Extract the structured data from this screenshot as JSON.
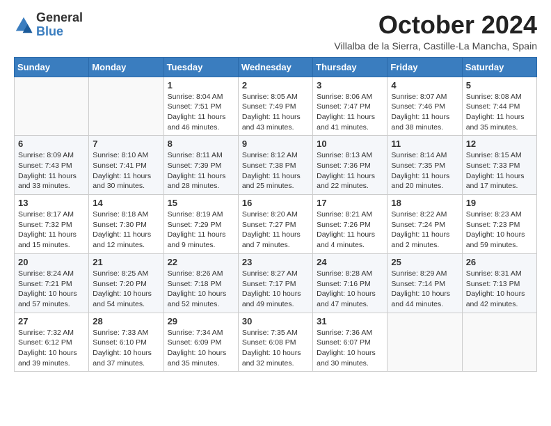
{
  "header": {
    "logo": {
      "line1": "General",
      "line2": "Blue"
    },
    "title": "October 2024",
    "location": "Villalba de la Sierra, Castille-La Mancha, Spain"
  },
  "weekdays": [
    "Sunday",
    "Monday",
    "Tuesday",
    "Wednesday",
    "Thursday",
    "Friday",
    "Saturday"
  ],
  "weeks": [
    [
      {
        "day": "",
        "info": ""
      },
      {
        "day": "",
        "info": ""
      },
      {
        "day": "1",
        "info": "Sunrise: 8:04 AM\nSunset: 7:51 PM\nDaylight: 11 hours and 46 minutes."
      },
      {
        "day": "2",
        "info": "Sunrise: 8:05 AM\nSunset: 7:49 PM\nDaylight: 11 hours and 43 minutes."
      },
      {
        "day": "3",
        "info": "Sunrise: 8:06 AM\nSunset: 7:47 PM\nDaylight: 11 hours and 41 minutes."
      },
      {
        "day": "4",
        "info": "Sunrise: 8:07 AM\nSunset: 7:46 PM\nDaylight: 11 hours and 38 minutes."
      },
      {
        "day": "5",
        "info": "Sunrise: 8:08 AM\nSunset: 7:44 PM\nDaylight: 11 hours and 35 minutes."
      }
    ],
    [
      {
        "day": "6",
        "info": "Sunrise: 8:09 AM\nSunset: 7:43 PM\nDaylight: 11 hours and 33 minutes."
      },
      {
        "day": "7",
        "info": "Sunrise: 8:10 AM\nSunset: 7:41 PM\nDaylight: 11 hours and 30 minutes."
      },
      {
        "day": "8",
        "info": "Sunrise: 8:11 AM\nSunset: 7:39 PM\nDaylight: 11 hours and 28 minutes."
      },
      {
        "day": "9",
        "info": "Sunrise: 8:12 AM\nSunset: 7:38 PM\nDaylight: 11 hours and 25 minutes."
      },
      {
        "day": "10",
        "info": "Sunrise: 8:13 AM\nSunset: 7:36 PM\nDaylight: 11 hours and 22 minutes."
      },
      {
        "day": "11",
        "info": "Sunrise: 8:14 AM\nSunset: 7:35 PM\nDaylight: 11 hours and 20 minutes."
      },
      {
        "day": "12",
        "info": "Sunrise: 8:15 AM\nSunset: 7:33 PM\nDaylight: 11 hours and 17 minutes."
      }
    ],
    [
      {
        "day": "13",
        "info": "Sunrise: 8:17 AM\nSunset: 7:32 PM\nDaylight: 11 hours and 15 minutes."
      },
      {
        "day": "14",
        "info": "Sunrise: 8:18 AM\nSunset: 7:30 PM\nDaylight: 11 hours and 12 minutes."
      },
      {
        "day": "15",
        "info": "Sunrise: 8:19 AM\nSunset: 7:29 PM\nDaylight: 11 hours and 9 minutes."
      },
      {
        "day": "16",
        "info": "Sunrise: 8:20 AM\nSunset: 7:27 PM\nDaylight: 11 hours and 7 minutes."
      },
      {
        "day": "17",
        "info": "Sunrise: 8:21 AM\nSunset: 7:26 PM\nDaylight: 11 hours and 4 minutes."
      },
      {
        "day": "18",
        "info": "Sunrise: 8:22 AM\nSunset: 7:24 PM\nDaylight: 11 hours and 2 minutes."
      },
      {
        "day": "19",
        "info": "Sunrise: 8:23 AM\nSunset: 7:23 PM\nDaylight: 10 hours and 59 minutes."
      }
    ],
    [
      {
        "day": "20",
        "info": "Sunrise: 8:24 AM\nSunset: 7:21 PM\nDaylight: 10 hours and 57 minutes."
      },
      {
        "day": "21",
        "info": "Sunrise: 8:25 AM\nSunset: 7:20 PM\nDaylight: 10 hours and 54 minutes."
      },
      {
        "day": "22",
        "info": "Sunrise: 8:26 AM\nSunset: 7:18 PM\nDaylight: 10 hours and 52 minutes."
      },
      {
        "day": "23",
        "info": "Sunrise: 8:27 AM\nSunset: 7:17 PM\nDaylight: 10 hours and 49 minutes."
      },
      {
        "day": "24",
        "info": "Sunrise: 8:28 AM\nSunset: 7:16 PM\nDaylight: 10 hours and 47 minutes."
      },
      {
        "day": "25",
        "info": "Sunrise: 8:29 AM\nSunset: 7:14 PM\nDaylight: 10 hours and 44 minutes."
      },
      {
        "day": "26",
        "info": "Sunrise: 8:31 AM\nSunset: 7:13 PM\nDaylight: 10 hours and 42 minutes."
      }
    ],
    [
      {
        "day": "27",
        "info": "Sunrise: 7:32 AM\nSunset: 6:12 PM\nDaylight: 10 hours and 39 minutes."
      },
      {
        "day": "28",
        "info": "Sunrise: 7:33 AM\nSunset: 6:10 PM\nDaylight: 10 hours and 37 minutes."
      },
      {
        "day": "29",
        "info": "Sunrise: 7:34 AM\nSunset: 6:09 PM\nDaylight: 10 hours and 35 minutes."
      },
      {
        "day": "30",
        "info": "Sunrise: 7:35 AM\nSunset: 6:08 PM\nDaylight: 10 hours and 32 minutes."
      },
      {
        "day": "31",
        "info": "Sunrise: 7:36 AM\nSunset: 6:07 PM\nDaylight: 10 hours and 30 minutes."
      },
      {
        "day": "",
        "info": ""
      },
      {
        "day": "",
        "info": ""
      }
    ]
  ]
}
